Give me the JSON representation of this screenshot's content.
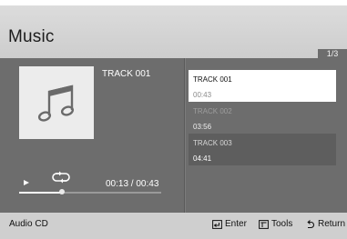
{
  "header": {
    "title": "Music",
    "page_indicator": "1/3"
  },
  "now_playing": {
    "track_title": "TRACK 001",
    "time": "00:13 / 00:43",
    "progress": 0.3,
    "album_art_icon": "music-note-icon"
  },
  "playlist": {
    "tracks": [
      {
        "name": "TRACK 001",
        "duration": "00:43",
        "state": "selected"
      },
      {
        "name": "TRACK 002",
        "duration": "03:56",
        "state": "normal"
      },
      {
        "name": "TRACK 003",
        "duration": "04:41",
        "state": "highlighted"
      }
    ]
  },
  "footer": {
    "source_label": "Audio CD",
    "enter_label": "Enter",
    "tools_label": "Tools",
    "return_label": "Return"
  },
  "colors": {
    "panel": "#6d6d6d",
    "header": "#d0d0d0",
    "selected_row": "#ffffff",
    "highlighted_row": "#5e5e5e"
  }
}
